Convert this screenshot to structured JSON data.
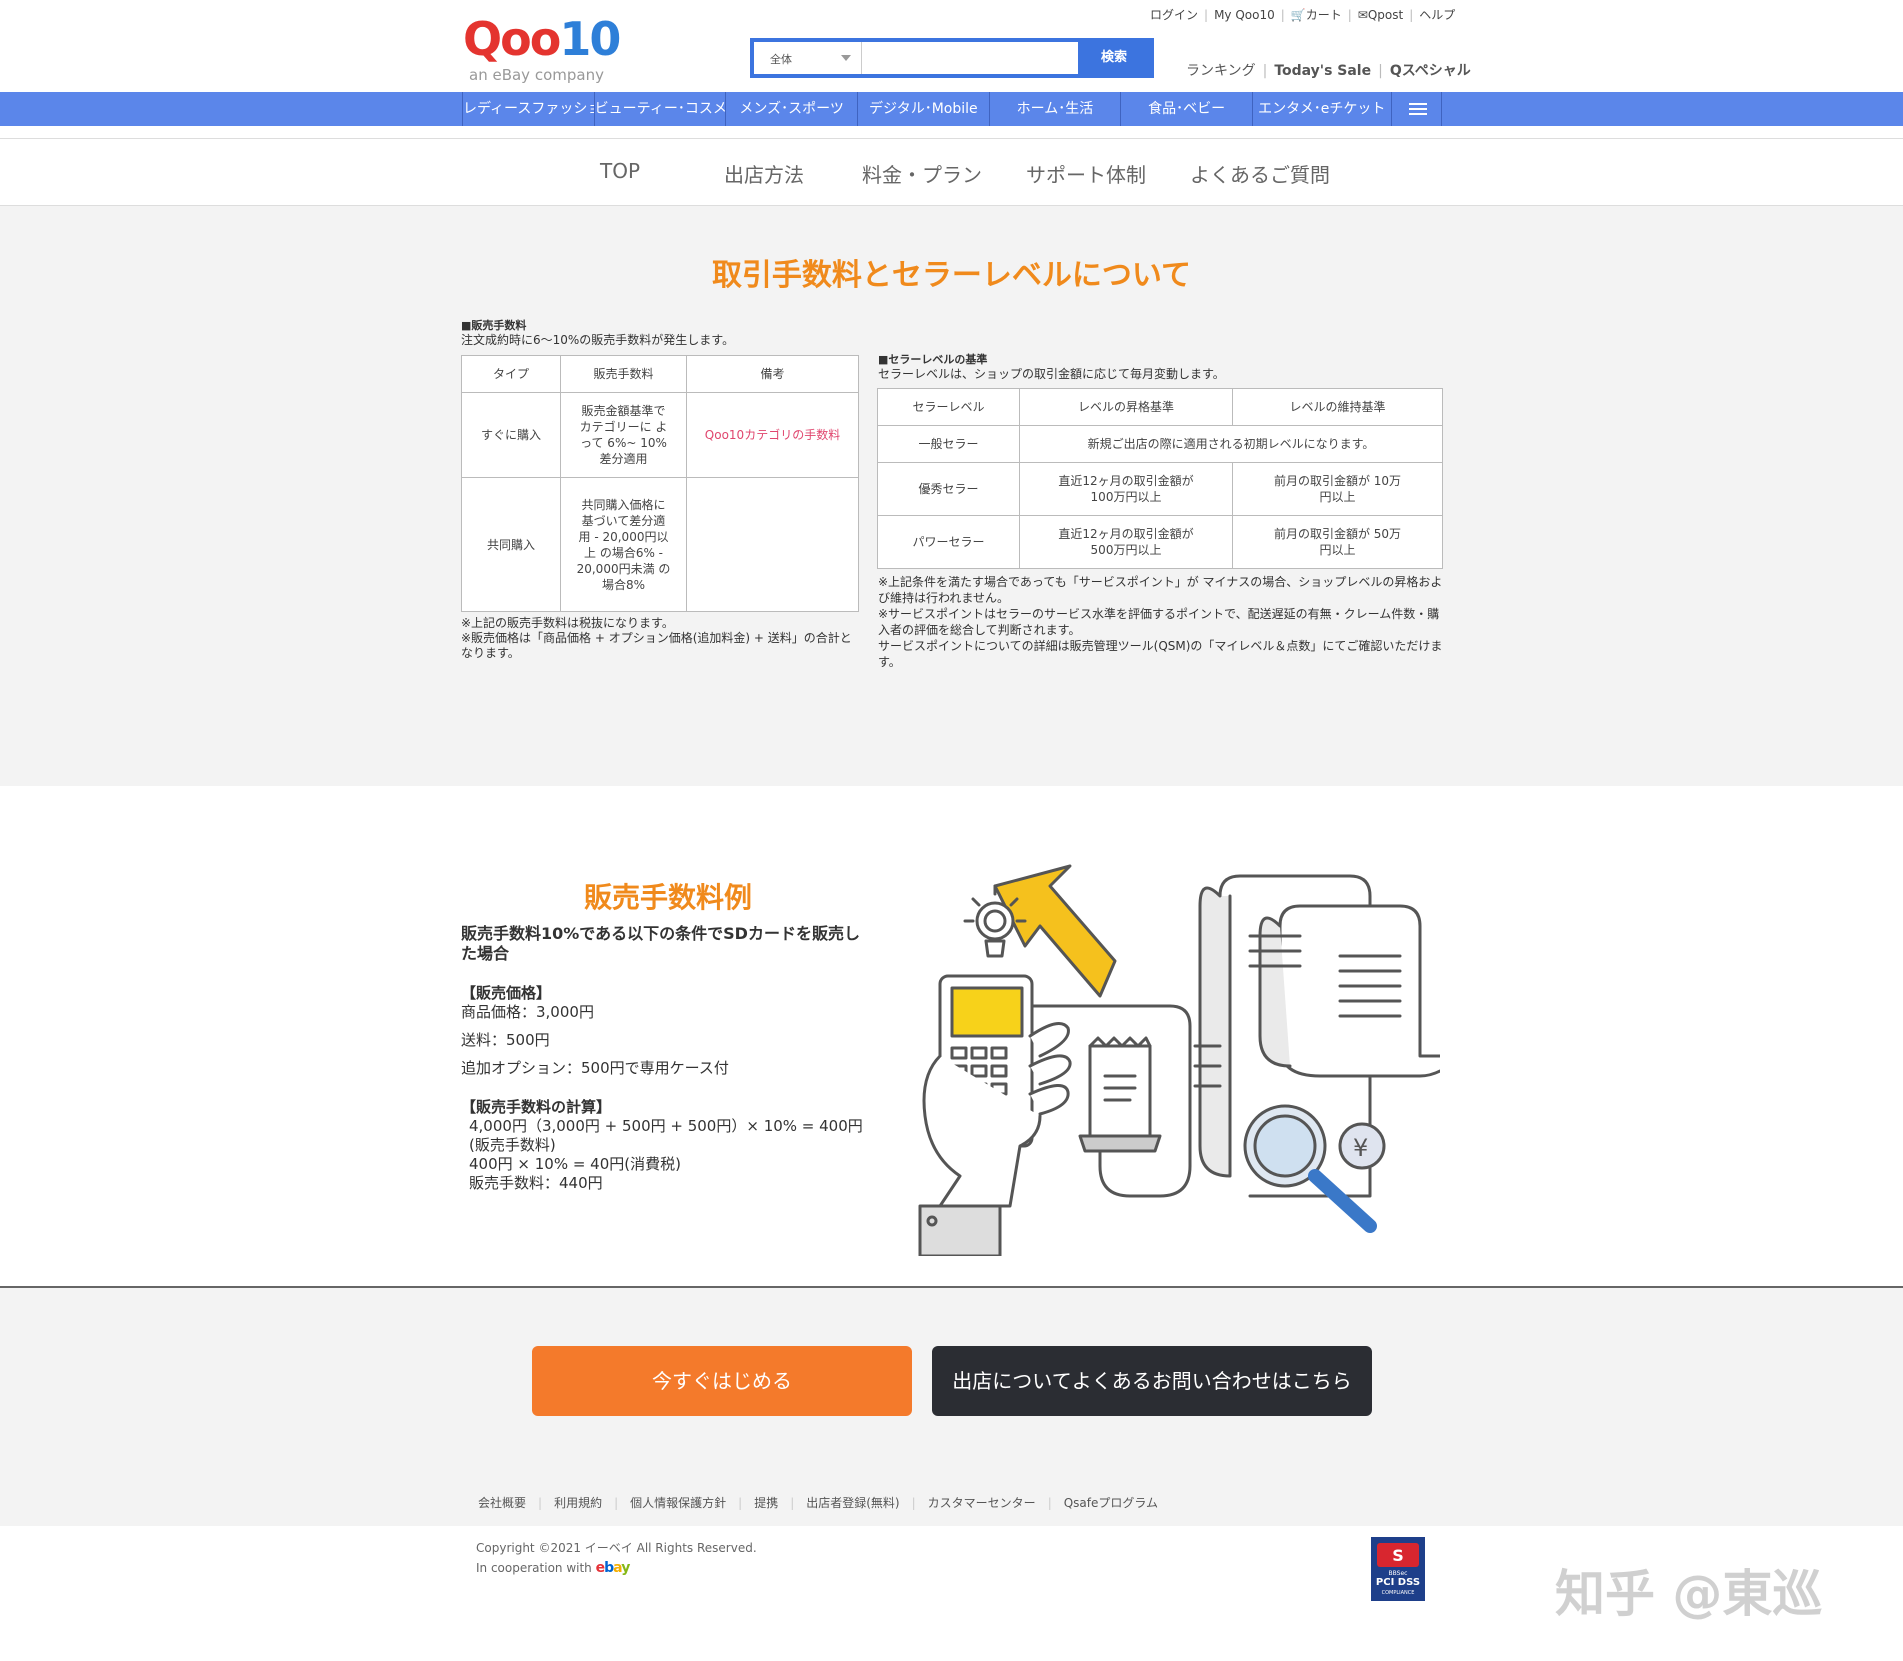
{
  "header": {
    "logo_text_q": "Qoo",
    "logo_text_ten": "10",
    "logo_tagline": "an eBay company",
    "search_category": "全体",
    "search_button": "検索",
    "top_links": [
      "ログイン",
      "My Qoo10",
      "カート",
      "Qpost",
      "ヘルプ"
    ],
    "sub_links": [
      "ランキング",
      "Today's Sale",
      "Qスペシャル"
    ]
  },
  "category_bar": {
    "items": [
      "レディースファッション",
      "ビューティー･コスメ",
      "メンズ･スポーツ",
      "デジタル･Mobile",
      "ホーム･生活",
      "食品･ベビー",
      "エンタメ･eチケット"
    ]
  },
  "subnav": {
    "items": [
      "TOP",
      "出店方法",
      "料金・プラン",
      "サポート体制",
      "よくあるご質問"
    ]
  },
  "fees": {
    "title": "取引手数料とセラーレベルについて",
    "sales_fee": {
      "heading": "■販売手数料",
      "desc": "注文成約時に6～10%の販売手数料が発生します。",
      "headers": [
        "タイプ",
        "販売手数料",
        "備考"
      ],
      "rows": [
        {
          "type": "すぐに購入",
          "fee": "販売金額基準で カテゴリーに よって 6%~ 10%差分適用",
          "note": "Qoo10カテゴリの手数料"
        },
        {
          "type": "共同購入",
          "fee": "共同購入価格に 基づいて差分適 用 - 20,000円以上 の場合6% - 20,000円未満 の場合8%",
          "note": ""
        }
      ],
      "notes": [
        "※上記の販売手数料は税抜になります。",
        "※販売価格は「商品価格 + オプション価格(追加料金) + 送料」の合計となります。"
      ]
    },
    "seller_level": {
      "heading": "■セラーレベルの基準",
      "desc": "セラーレベルは、ショップの取引金額に応じて毎月変動します。",
      "headers": [
        "セラーレベル",
        "レベルの昇格基準",
        "レベルの維持基準"
      ],
      "rows": [
        {
          "level": "一般セラー",
          "up": "新規ご出店の際に適用される初期レベルになります。",
          "keep": ""
        },
        {
          "level": "優秀セラー",
          "up": "直近12ヶ月の取引金額が 100万円以上",
          "keep": "前月の取引金額が 10万円以上"
        },
        {
          "level": "パワーセラー",
          "up": "直近12ヶ月の取引金額が 500万円以上",
          "keep": "前月の取引金額が 50万円以上"
        }
      ],
      "notes": [
        "※上記条件を満たす場合であっても「サービスポイント」が マイナスの場合、ショップレベルの昇格および維持は行われません。",
        "※サービスポイントはセラーのサービス水準を評価するポイントで、配送遅延の有無・クレーム件数・購入者の評価を総合して判断されます。",
        "サービスポイントについての詳細は販売管理ツール(QSM)の「マイレベル＆点数」にてご確認いただけます。"
      ]
    }
  },
  "example": {
    "title": "販売手数料例",
    "lead": "販売手数料10%である以下の条件でSDカードを販売した場合",
    "price_heading": "【販売価格】",
    "price_lines": [
      "商品価格：3,000円",
      "送料：500円",
      "追加オプション：500円で専用ケース付"
    ],
    "calc_heading": "【販売手数料の計算】",
    "calc_lines": [
      "4,000円（3,000円 + 500円 + 500円）× 10% = 400円(販売手数料)",
      "400円 × 10% = 40円(消費税)",
      "販売手数料：440円"
    ]
  },
  "cta": {
    "start": "今すぐはじめる",
    "faq": "出店についてよくあるお問い合わせはこちら"
  },
  "footer": {
    "links": [
      "会社概要",
      "利用規約",
      "個人情報保護方針",
      "提携",
      "出店者登録(無料)",
      "カスタマーセンター",
      "Qsafeプログラム"
    ],
    "copyright": "Copyright ©2021 イーベイ All Rights Reserved.",
    "cooperation": "In cooperation with",
    "ebay": "ebay",
    "badge_top": "BBSec",
    "badge_main": "PCI DSS",
    "badge_sub": "COMPLIANCE",
    "watermark": "知乎 @東巡"
  },
  "colors": {
    "brand_blue": "#5b86ea",
    "accent_orange": "#f08a1c",
    "cta_orange": "#f47a2b",
    "cta_dark": "#2b2d33"
  }
}
